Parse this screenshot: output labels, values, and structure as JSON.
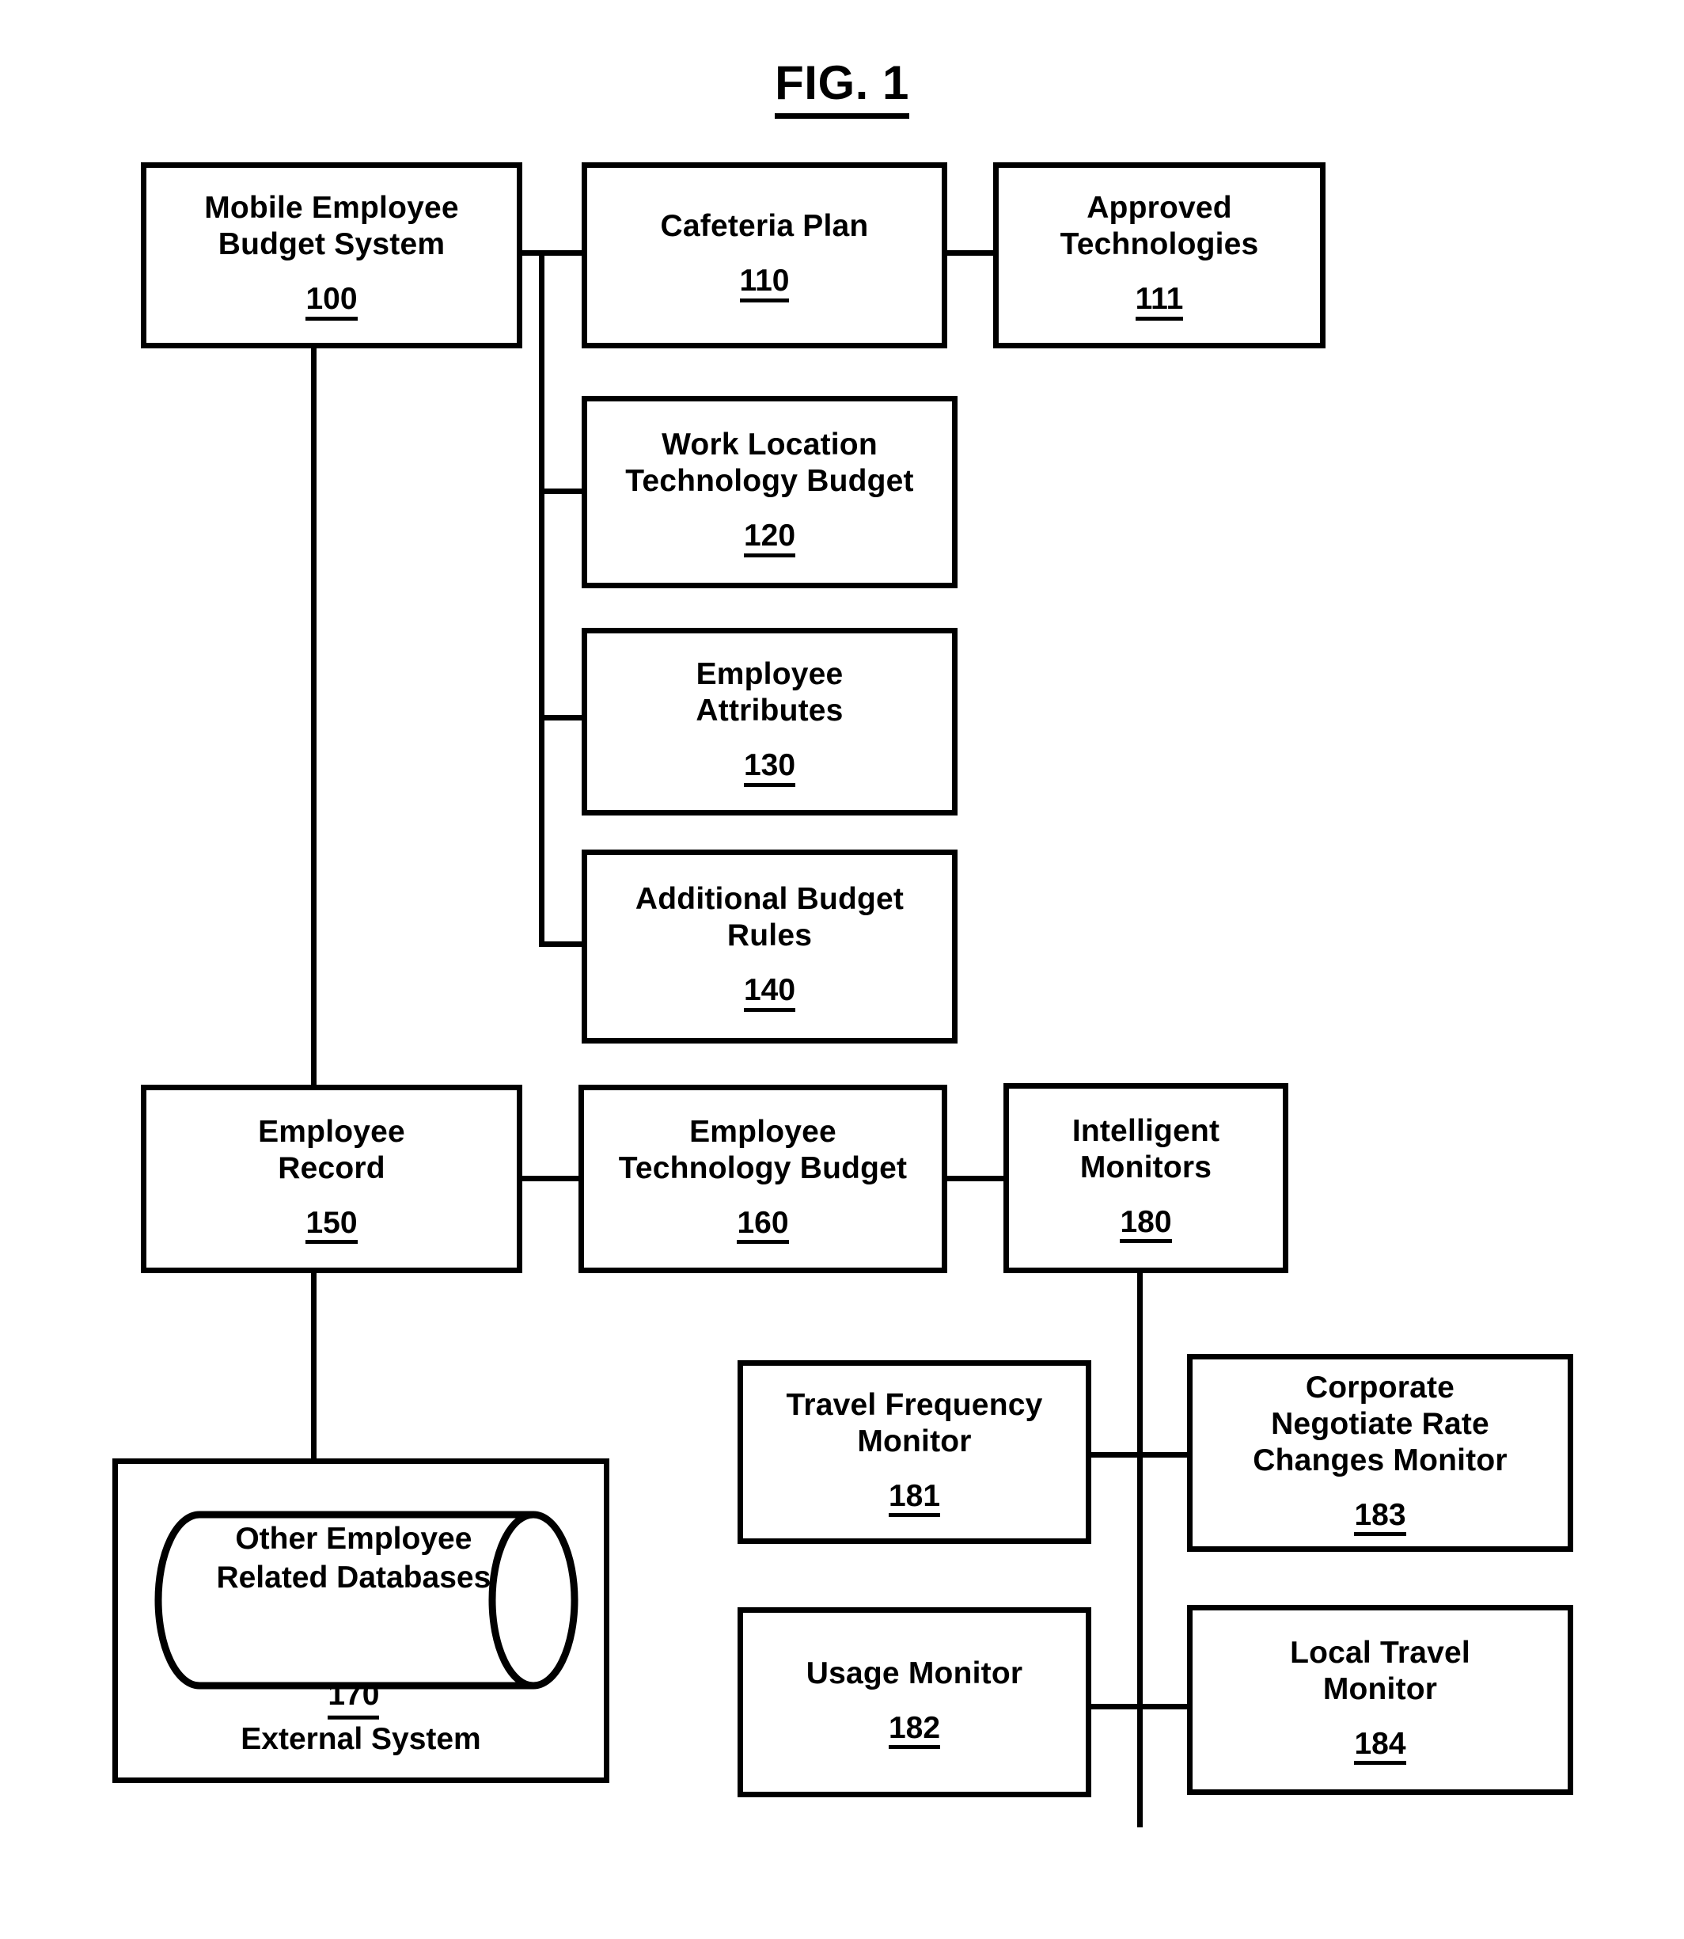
{
  "figure": {
    "title": "FIG. 1"
  },
  "nodes": {
    "system": {
      "label": "Mobile Employee\nBudget System",
      "ref": "100"
    },
    "cafeteria_plan": {
      "label": "Cafeteria Plan",
      "ref": "110"
    },
    "approved_technologies": {
      "label": "Approved\nTechnologies",
      "ref": "111"
    },
    "work_location_budget": {
      "label": "Work Location\nTechnology Budget",
      "ref": "120"
    },
    "employee_attributes": {
      "label": "Employee\nAttributes",
      "ref": "130"
    },
    "additional_budget_rules": {
      "label": "Additional Budget\nRules",
      "ref": "140"
    },
    "employee_record": {
      "label": "Employee\nRecord",
      "ref": "150"
    },
    "employee_technology_budget": {
      "label": "Employee\nTechnology Budget",
      "ref": "160"
    },
    "intelligent_monitors": {
      "label": "Intelligent\nMonitors",
      "ref": "180"
    },
    "other_databases": {
      "label": "Other Employee\nRelated Databases",
      "ref": "170"
    },
    "external_system": {
      "caption": "External System"
    },
    "travel_frequency_monitor": {
      "label": "Travel Frequency\nMonitor",
      "ref": "181"
    },
    "usage_monitor": {
      "label": "Usage Monitor",
      "ref": "182"
    },
    "corporate_rate_monitor": {
      "label": "Corporate\nNegotiate Rate\nChanges Monitor",
      "ref": "183"
    },
    "local_travel_monitor": {
      "label": "Local Travel\nMonitor",
      "ref": "184"
    }
  },
  "style": {
    "line_color": "#000000",
    "background": "#ffffff"
  }
}
